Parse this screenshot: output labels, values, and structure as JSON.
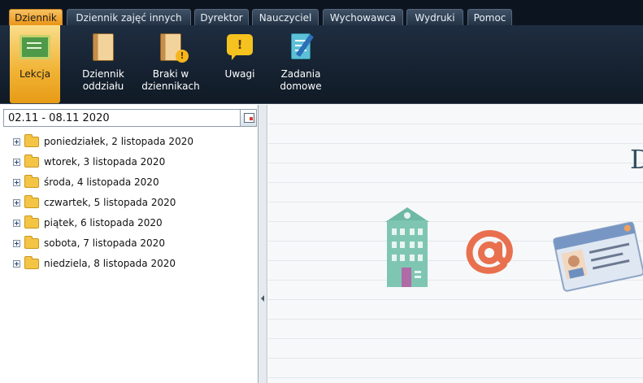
{
  "menu": {
    "tabs": [
      {
        "label": "Dziennik",
        "active": true
      },
      {
        "label": "Dziennik zajęć innych",
        "active": false
      },
      {
        "label": "Dyrektor",
        "active": false
      },
      {
        "label": "Nauczyciel",
        "active": false
      },
      {
        "label": "Wychowawca",
        "active": false
      },
      {
        "label": "Wydruki",
        "active": false
      },
      {
        "label": "Pomoc",
        "active": false
      }
    ]
  },
  "toolbar": {
    "buttons": [
      {
        "label": "Lekcja",
        "icon": "chalkboard-icon",
        "active": true
      },
      {
        "label": "Dziennik oddziału",
        "icon": "book-icon",
        "active": false
      },
      {
        "label": "Braki w dziennikach",
        "icon": "book-warning-icon",
        "active": false
      },
      {
        "label": "Uwagi",
        "icon": "exclamation-bubble-icon",
        "active": false
      },
      {
        "label": "Zadania domowe",
        "icon": "notepad-pen-icon",
        "active": false
      }
    ]
  },
  "left_panel": {
    "date_range": "02.11 - 08.11 2020",
    "days": [
      "poniedziałek, 2 listopada 2020",
      "wtorek, 3 listopada 2020",
      "środa, 4 listopada 2020",
      "czwartek, 5 listopada 2020",
      "piątek, 6 listopada 2020",
      "sobota, 7 listopada 2020",
      "niedziela, 8 listopada 2020"
    ]
  },
  "right_panel": {
    "partial_heading": "D",
    "illustrations": [
      "building-icon",
      "at-sign-icon",
      "id-card-icon"
    ]
  },
  "colors": {
    "active_tab": "#f0a52a",
    "toolbar_bg": "#162434",
    "folder": "#f4c545",
    "at_sign": "#e8704e",
    "building": "#7fc6b2"
  }
}
